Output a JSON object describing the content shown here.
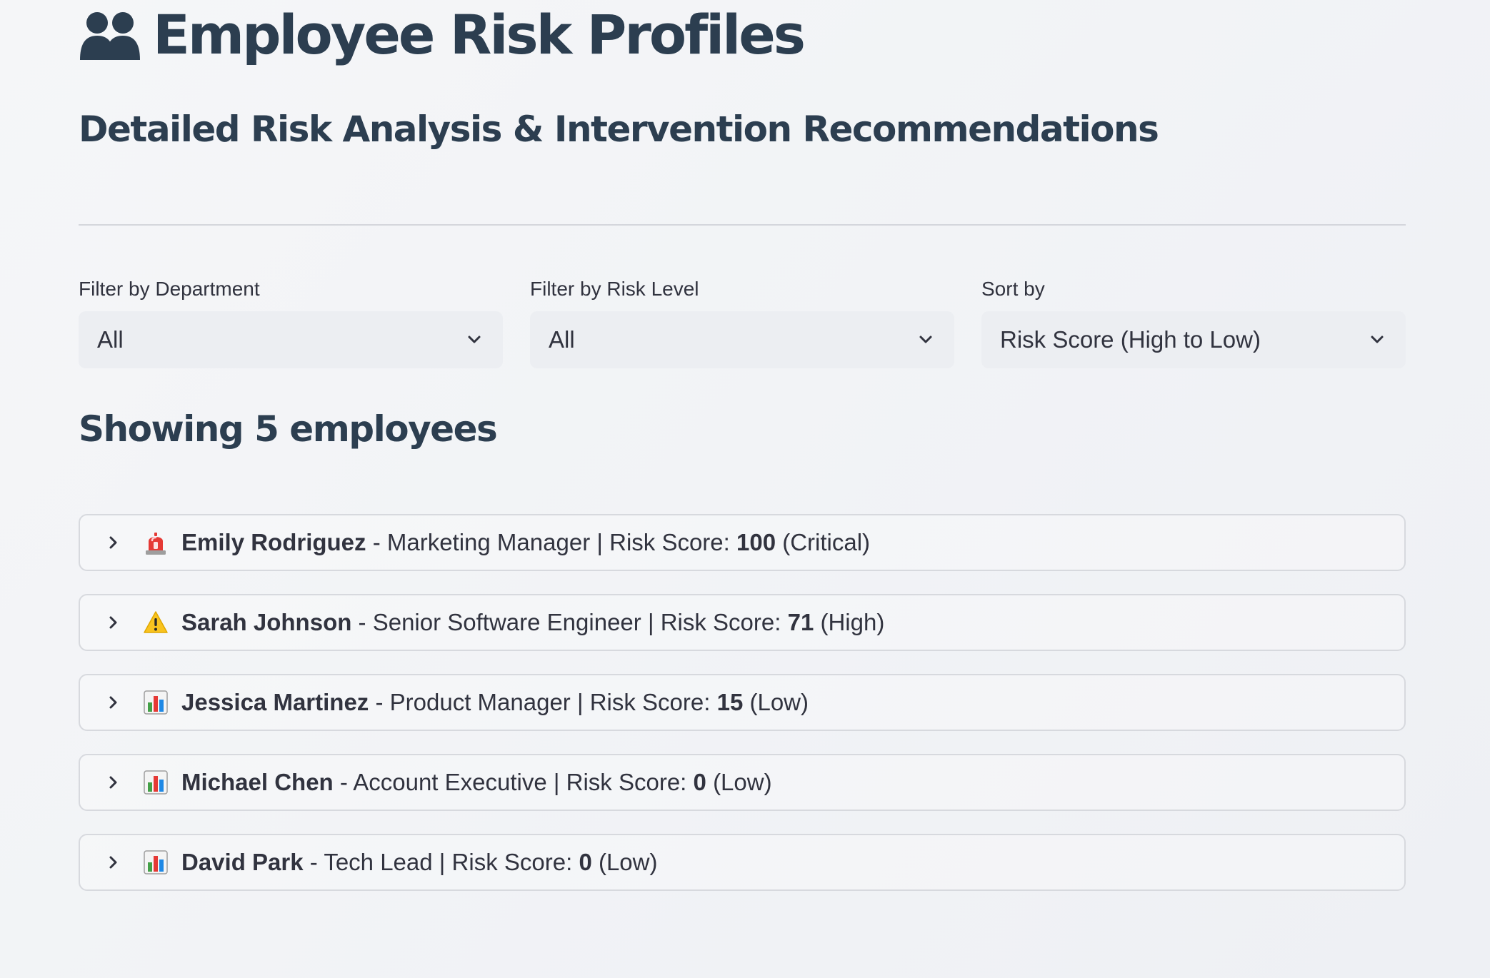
{
  "header": {
    "title": "Employee Risk Profiles",
    "title_icon": "two-people-icon",
    "subtitle": "Detailed Risk Analysis & Intervention Recommendations"
  },
  "filters": {
    "department": {
      "label": "Filter by Department",
      "value": "All"
    },
    "risk_level": {
      "label": "Filter by Risk Level",
      "value": "All"
    },
    "sort": {
      "label": "Sort by",
      "value": "Risk Score (High to Low)"
    }
  },
  "results": {
    "count_text": "Showing 5 employees"
  },
  "score_label": "Risk Score:",
  "employees": [
    {
      "icon": "siren-icon",
      "name": "Emily Rodriguez",
      "role": "Marketing Manager",
      "score": "100",
      "level": "(Critical)"
    },
    {
      "icon": "warning-icon",
      "name": "Sarah Johnson",
      "role": "Senior Software Engineer",
      "score": "71",
      "level": "(High)"
    },
    {
      "icon": "bar-chart-icon",
      "name": "Jessica Martinez",
      "role": "Product Manager",
      "score": "15",
      "level": "(Low)"
    },
    {
      "icon": "bar-chart-icon",
      "name": "Michael Chen",
      "role": "Account Executive",
      "score": "0",
      "level": "(Low)"
    },
    {
      "icon": "bar-chart-icon",
      "name": "David Park",
      "role": "Tech Lead",
      "score": "0",
      "level": "(Low)"
    }
  ],
  "colors": {
    "heading": "#2c3e50",
    "text": "#31333f",
    "border": "#d7d9de",
    "select_bg": "#eceef2",
    "siren_red": "#e53935",
    "warning_yellow": "#f9c31f"
  }
}
